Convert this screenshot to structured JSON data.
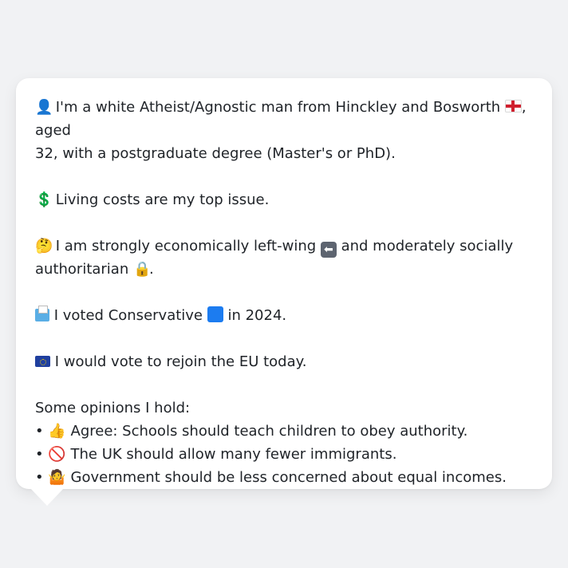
{
  "message": {
    "intro_part1": " I'm a white Atheist/Agnostic man from Hinckley and Bosworth ",
    "intro_part2": ", aged",
    "intro_line2": "32, with a postgraduate degree (Master's or PhD).",
    "issue": " Living costs are my top issue.",
    "econ_part1": " I am strongly economically left-wing ",
    "econ_part2": " and moderately socially",
    "econ_line2": "authoritarian ",
    "econ_line2_end": ".",
    "vote_part1": " I voted Conservative ",
    "vote_part2": " in 2024.",
    "eu": " I would vote to rejoin the EU today.",
    "opinions_heading": "Some opinions I hold:",
    "opinions": [
      {
        "bullet": "•",
        "emoji": "👍",
        "text": " Agree: Schools should teach children to obey authority."
      },
      {
        "bullet": "•",
        "emoji": "🚫",
        "text": " The UK should allow many fewer immigrants."
      },
      {
        "bullet": "•",
        "emoji": "🤷",
        "text": " Government should be less concerned about equal incomes."
      }
    ]
  },
  "icons": {
    "person": "person-icon",
    "england_flag": "england-flag-icon",
    "dollar": "dollar-icon",
    "thinking": "thinking-face-icon",
    "left_arrow": "left-arrow-icon",
    "lock": "lock-icon",
    "ballot": "ballot-box-icon",
    "blue_square": "blue-square-icon",
    "eu_flag": "eu-flag-icon"
  },
  "emoji_glyphs": {
    "person": "👤",
    "dollar": "💲",
    "thinking": "🤔",
    "left_arrow": "⬅",
    "lock": "🔒"
  },
  "colors": {
    "background": "#f1f2f4",
    "bubble": "#ffffff",
    "text": "#1f2328",
    "conservative_blue": "#1c7cf0"
  }
}
